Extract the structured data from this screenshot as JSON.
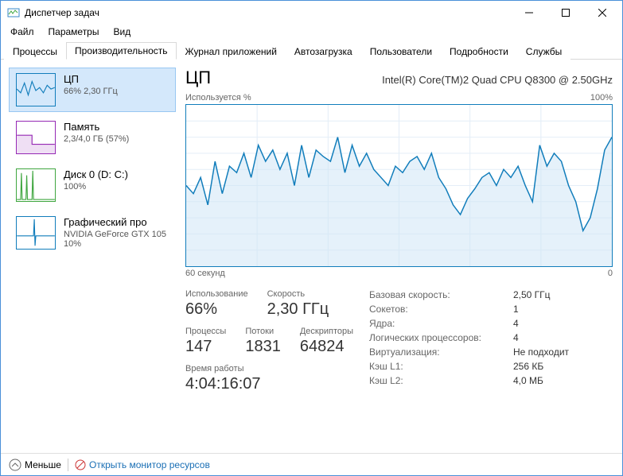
{
  "window": {
    "title": "Диспетчер задач"
  },
  "menu": [
    "Файл",
    "Параметры",
    "Вид"
  ],
  "tabs": [
    "Процессы",
    "Производительность",
    "Журнал приложений",
    "Автозагрузка",
    "Пользователи",
    "Подробности",
    "Службы"
  ],
  "active_tab": 1,
  "sidebar": [
    {
      "title": "ЦП",
      "sub": "66% 2,30 ГГц",
      "color": "#117dbb",
      "active": true
    },
    {
      "title": "Память",
      "sub": "2,3/4,0 ГБ (57%)",
      "color": "#9528b4",
      "active": false
    },
    {
      "title": "Диск 0 (D: C:)",
      "sub": "100%",
      "color": "#3fa63f",
      "active": false
    },
    {
      "title": "Графический про",
      "sub": "NVIDIA GeForce GTX 105",
      "sub2": "10%",
      "color": "#117dbb",
      "active": false
    }
  ],
  "main": {
    "title": "ЦП",
    "subtitle": "Intel(R) Core(TM)2 Quad CPU Q8300 @ 2.50GHz",
    "chart_top_left": "Используется %",
    "chart_top_right": "100%",
    "chart_bottom_left": "60 секунд",
    "chart_bottom_right": "0",
    "left_stats": [
      [
        {
          "label": "Использование",
          "value": "66%"
        },
        {
          "label": "Скорость",
          "value": "2,30 ГГц"
        }
      ],
      [
        {
          "label": "Процессы",
          "value": "147"
        },
        {
          "label": "Потоки",
          "value": "1831"
        },
        {
          "label": "Дескрипторы",
          "value": "64824"
        }
      ],
      [
        {
          "label": "Время работы",
          "value": "4:04:16:07"
        }
      ]
    ],
    "right_stats": [
      {
        "k": "Базовая скорость:",
        "v": "2,50 ГГц"
      },
      {
        "k": "Сокетов:",
        "v": "1"
      },
      {
        "k": "Ядра:",
        "v": "4"
      },
      {
        "k": "Логических процессоров:",
        "v": "4"
      },
      {
        "k": "Виртуализация:",
        "v": "Не подходит"
      },
      {
        "k": "Кэш L1:",
        "v": "256 КБ"
      },
      {
        "k": "Кэш L2:",
        "v": "4,0 МБ"
      }
    ]
  },
  "footer": {
    "less": "Меньше",
    "monitor": "Открыть монитор ресурсов"
  },
  "chart_data": {
    "type": "line",
    "title": "Используется %",
    "xlabel": "60 секунд → 0",
    "ylabel": "%",
    "ylim": [
      0,
      100
    ],
    "x_range_seconds": [
      60,
      0
    ],
    "values": [
      50,
      45,
      55,
      38,
      65,
      45,
      62,
      58,
      70,
      55,
      75,
      65,
      72,
      60,
      70,
      50,
      75,
      55,
      72,
      68,
      65,
      80,
      58,
      75,
      62,
      70,
      60,
      55,
      50,
      62,
      58,
      65,
      68,
      60,
      70,
      55,
      48,
      38,
      32,
      42,
      48,
      55,
      58,
      50,
      60,
      55,
      62,
      50,
      40,
      75,
      62,
      70,
      65,
      50,
      40,
      22,
      30,
      48,
      72,
      80
    ]
  }
}
